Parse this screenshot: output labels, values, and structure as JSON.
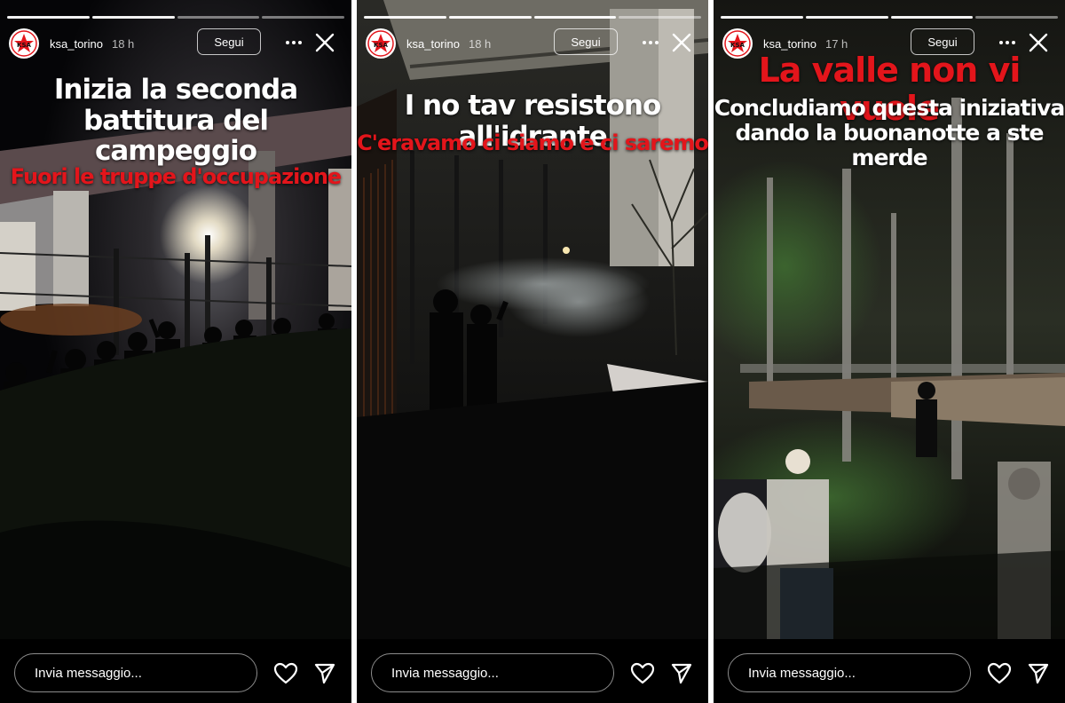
{
  "stories": [
    {
      "username": "ksa_torino",
      "time": "18 h",
      "follow_label": "Segui",
      "avatar_text": "KSA",
      "caption_lines": [
        "Inizia la seconda battitura del",
        "campeggio"
      ],
      "caption_red": "Fuori le truppe d'occupazione",
      "message_placeholder": "Invia messaggio..."
    },
    {
      "username": "ksa_torino",
      "time": "18 h",
      "follow_label": "Segui",
      "avatar_text": "KSA",
      "caption_lines": [
        "I no tav resistono all'idrante"
      ],
      "caption_red": "C'eravamo ci siamo e ci saremo",
      "message_placeholder": "Invia messaggio..."
    },
    {
      "username": "ksa_torino",
      "time": "17 h",
      "follow_label": "Segui",
      "avatar_text": "KSA",
      "caption_red_top": "La valle non vi vuole",
      "caption_lines": [
        "Concludiamo questa iniziativa",
        "dando la buonanotte a ste",
        "merde"
      ],
      "message_placeholder": "Invia messaggio..."
    }
  ],
  "icons": {
    "more": "more-options-icon",
    "close": "close-icon",
    "heart": "heart-icon",
    "send": "send-icon"
  },
  "colors": {
    "caption_red": "#e3151b",
    "background": "#000000",
    "text": "#ffffff"
  }
}
